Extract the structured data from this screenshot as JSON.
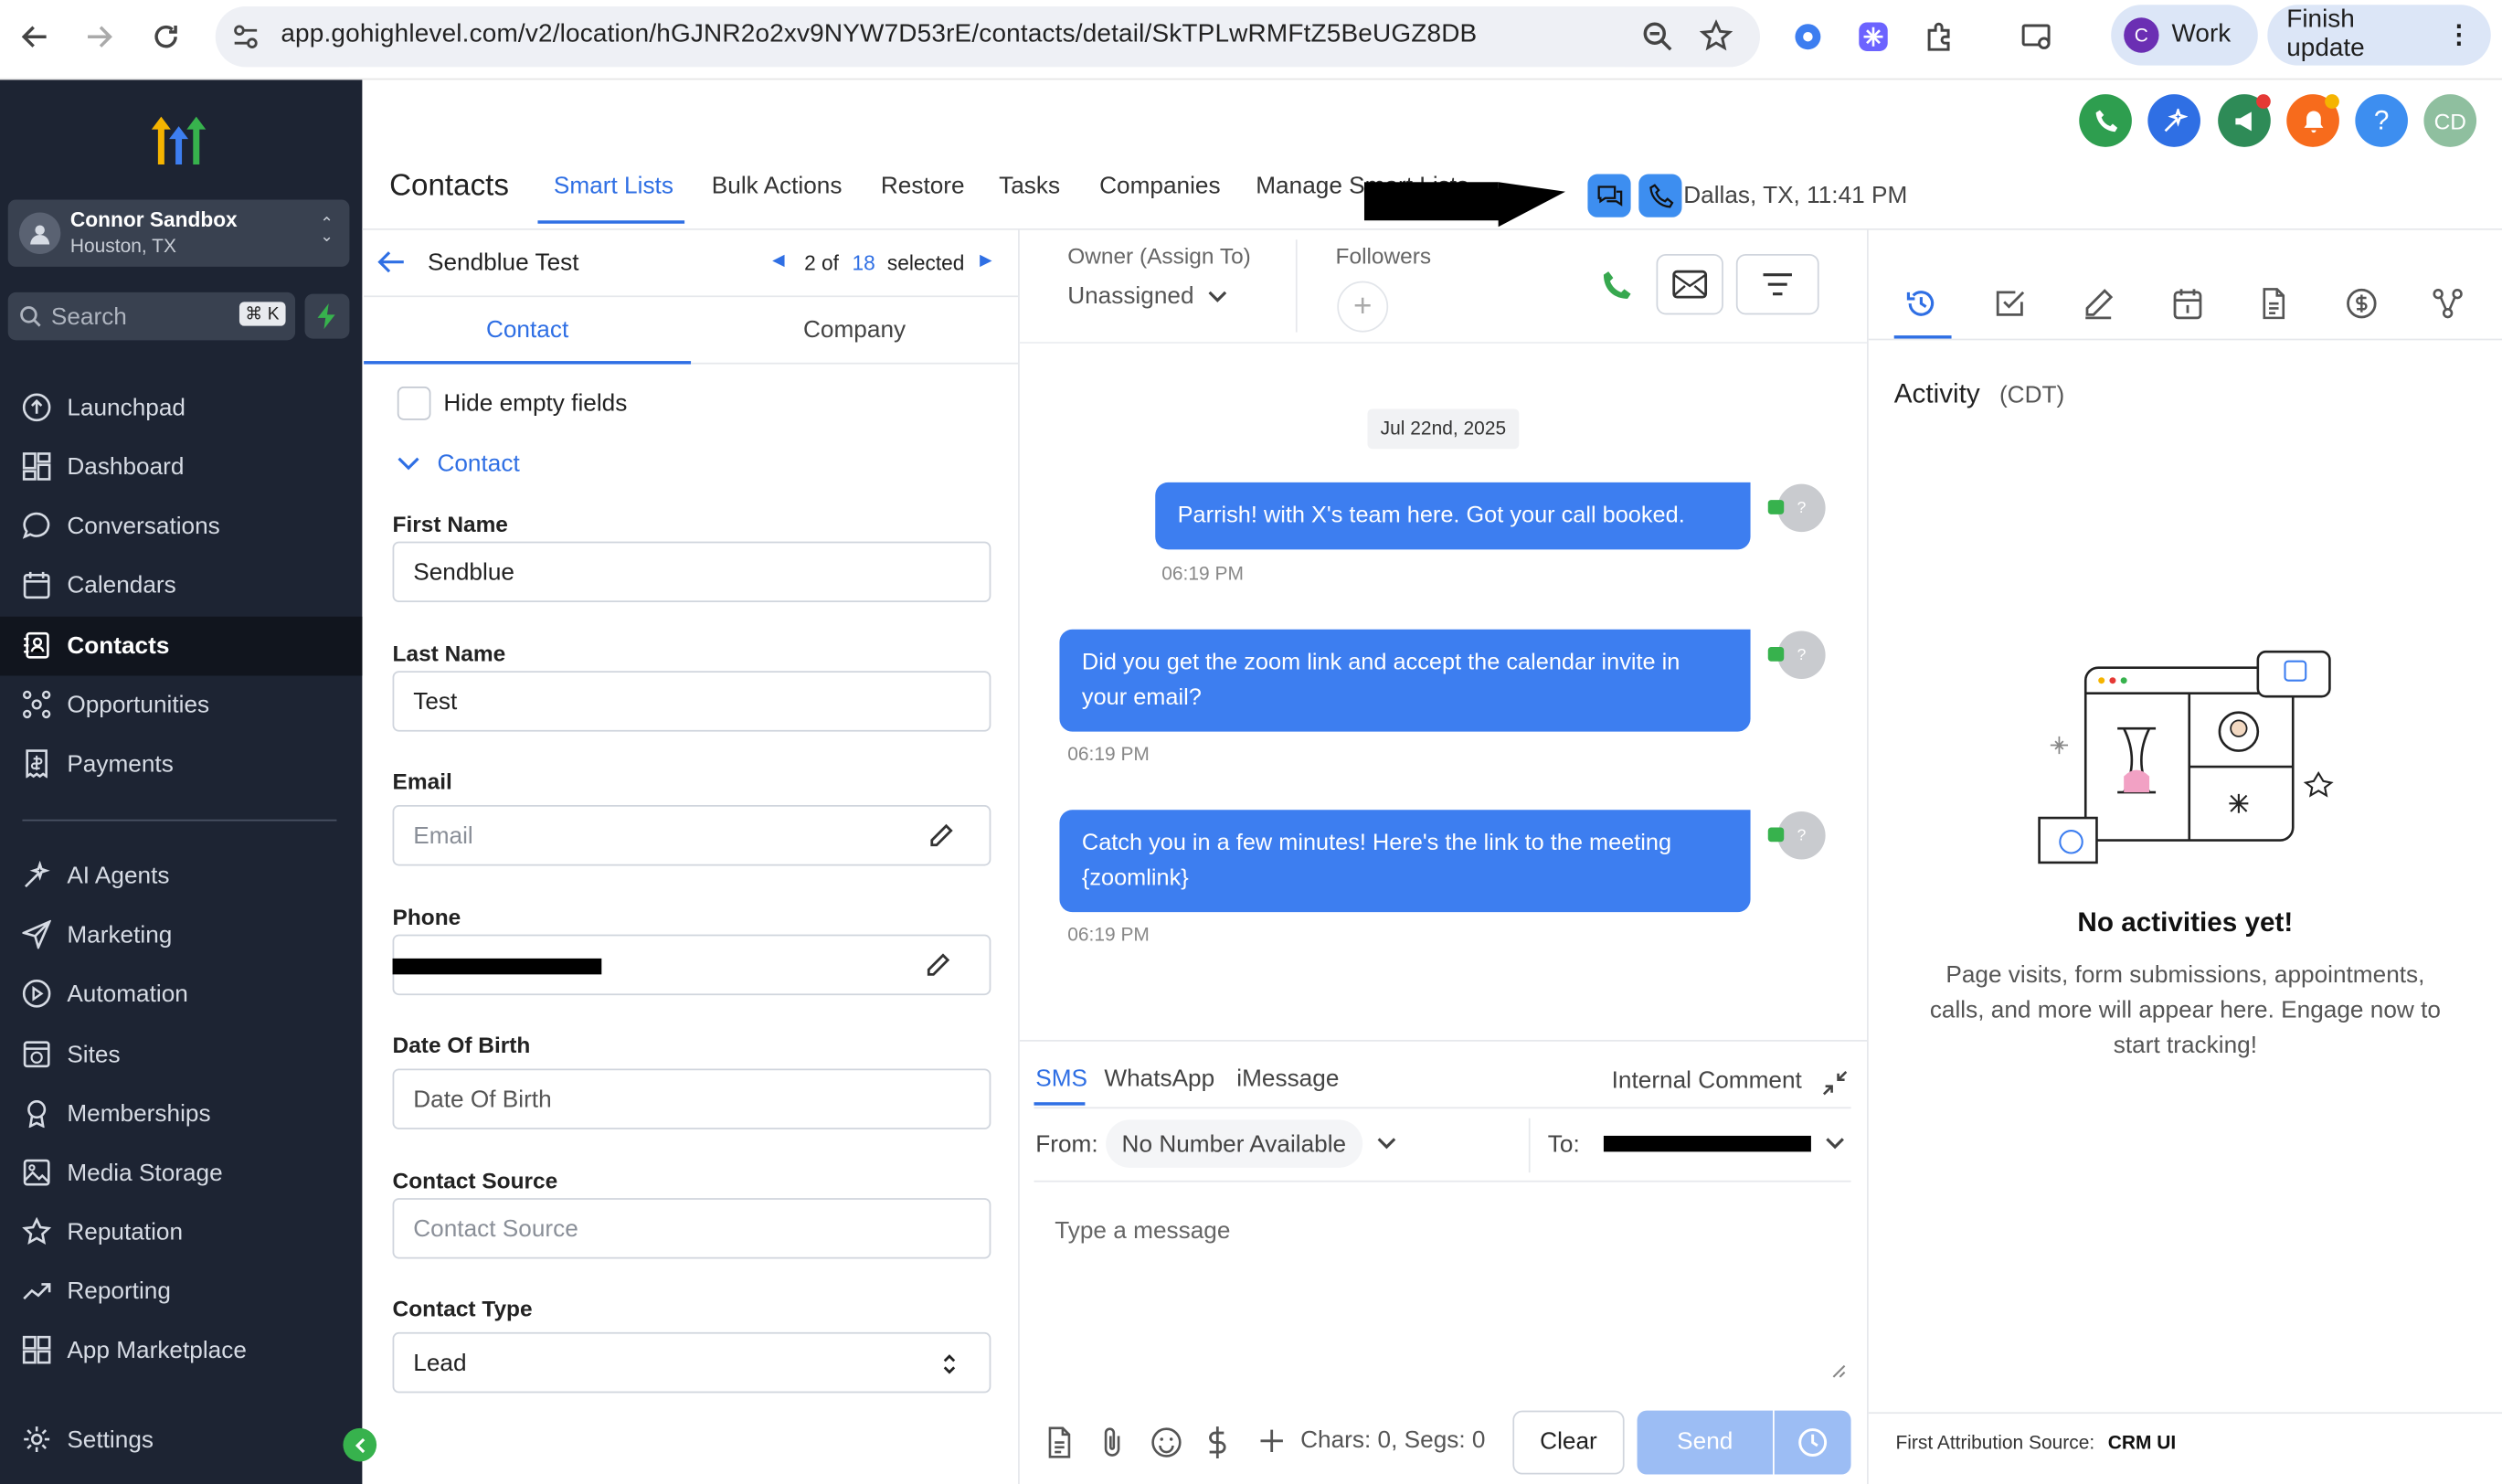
{
  "browser": {
    "url": "app.gohighlevel.com/v2/location/hGJNR2o2xv9NYW7D53rE/contacts/detail/SkTPLwRMFtZ5BeUGZ8DB",
    "profile_initial": "C",
    "profile_label": "Work",
    "update_label": "Finish update"
  },
  "sidebar": {
    "account_name": "Connor Sandbox",
    "account_location": "Houston, TX",
    "search_placeholder": "Search",
    "search_shortcut": "⌘ K",
    "items": [
      {
        "label": "Launchpad"
      },
      {
        "label": "Dashboard"
      },
      {
        "label": "Conversations"
      },
      {
        "label": "Calendars"
      },
      {
        "label": "Contacts"
      },
      {
        "label": "Opportunities"
      },
      {
        "label": "Payments"
      },
      {
        "label": "AI Agents"
      },
      {
        "label": "Marketing"
      },
      {
        "label": "Automation"
      },
      {
        "label": "Sites"
      },
      {
        "label": "Memberships"
      },
      {
        "label": "Media Storage"
      },
      {
        "label": "Reputation"
      },
      {
        "label": "Reporting"
      },
      {
        "label": "App Marketplace"
      }
    ],
    "settings_label": "Settings"
  },
  "header": {
    "title": "Contacts",
    "tabs": [
      "Smart Lists",
      "Bulk Actions",
      "Restore",
      "Tasks",
      "Companies",
      "Manage Smart Lists"
    ],
    "location_time": "Dallas, TX, 11:41 PM",
    "user_initials": "CD"
  },
  "contact_panel": {
    "name": "Sendblue Test",
    "pager_current": "2 of",
    "pager_total": "18",
    "pager_suffix": "selected",
    "tab_contact": "Contact",
    "tab_company": "Company",
    "hide_empty_label": "Hide empty fields",
    "section_label": "Contact",
    "fields": {
      "first_name_label": "First Name",
      "first_name_value": "Sendblue",
      "last_name_label": "Last Name",
      "last_name_value": "Test",
      "email_label": "Email",
      "email_placeholder": "Email",
      "phone_label": "Phone",
      "dob_label": "Date Of Birth",
      "dob_placeholder": "Date Of Birth",
      "source_label": "Contact Source",
      "source_placeholder": "Contact Source",
      "type_label": "Contact Type",
      "type_value": "Lead"
    }
  },
  "conversation": {
    "owner_label": "Owner (Assign To)",
    "owner_value": "Unassigned",
    "followers_label": "Followers",
    "date_chip": "Jul 22nd, 2025",
    "messages": [
      {
        "text": "Parrish!  with X's team here. Got your call booked.",
        "time": "06:19 PM"
      },
      {
        "text": "Did you get the zoom link and accept the calendar invite in your email?",
        "time": "06:19 PM"
      },
      {
        "text": "Catch you in a few minutes! Here's the link to the meeting {zoomlink}",
        "time": "06:19 PM"
      }
    ],
    "avatar_glyph": "?",
    "channels": [
      "SMS",
      "WhatsApp",
      "iMessage"
    ],
    "internal_comment": "Internal Comment",
    "from_label": "From:",
    "from_value": "No Number Available",
    "to_label": "To:",
    "message_placeholder": "Type a message",
    "chars_label": "Chars: 0, Segs: 0",
    "clear_label": "Clear",
    "send_label": "Send"
  },
  "activity": {
    "title": "Activity",
    "timezone": "(CDT)",
    "empty_title": "No activities yet!",
    "empty_text": "Page visits, form submissions, appointments, calls, and more will appear here. Engage now to start tracking!",
    "attribution_label": "First Attribution Source:",
    "attribution_value": "CRM UI"
  },
  "colors": {
    "sidebar_bg": "#1d2433",
    "accent": "#3d7ef0",
    "tab_active": "#2f6fe4"
  }
}
